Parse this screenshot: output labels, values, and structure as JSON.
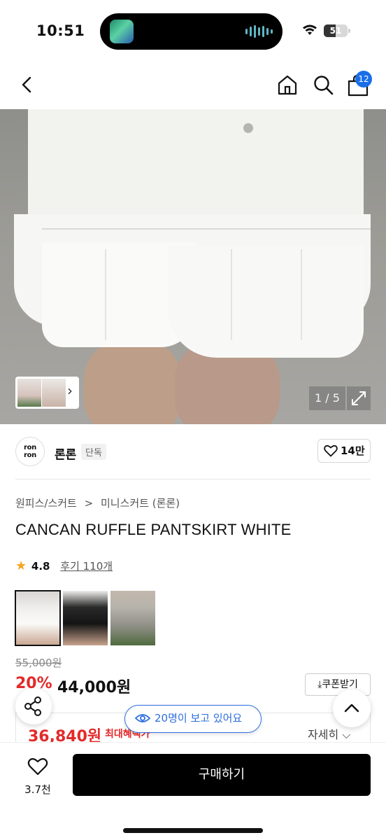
{
  "status_bar": {
    "time": "10:51",
    "battery": "51"
  },
  "header": {
    "cart_count": "12"
  },
  "hero": {
    "counter": "1 / 5"
  },
  "brand": {
    "logo_text_top": "ron",
    "logo_text_bottom": "ron",
    "name": "론론",
    "tag": "단독",
    "likes": "14만"
  },
  "product": {
    "breadcrumb": [
      "원피스/스커트",
      ">",
      "미니스커트 (론론)"
    ],
    "title": "CANCAN RUFFLE PANTSKIRT WHITE",
    "rating": "4.8",
    "reviews": "후기 110개",
    "original_price": "55,000원",
    "discount": "20%",
    "price": "44,000원",
    "coupon": "쿠폰받기",
    "coupon_icon": "download-icon",
    "benefit_price": "36,840원",
    "benefit_label": "최대혜택가",
    "benefit_detail": "자세히"
  },
  "overlay": {
    "viewers": "20명이 보고 있어요"
  },
  "bottom_bar": {
    "wish_count": "3.7천",
    "buy_label": "구매하기"
  },
  "colors": {
    "accent_blue": "#2d6ee0",
    "sale_red": "#e32a2a",
    "badge_blue": "#1a6fe8"
  }
}
